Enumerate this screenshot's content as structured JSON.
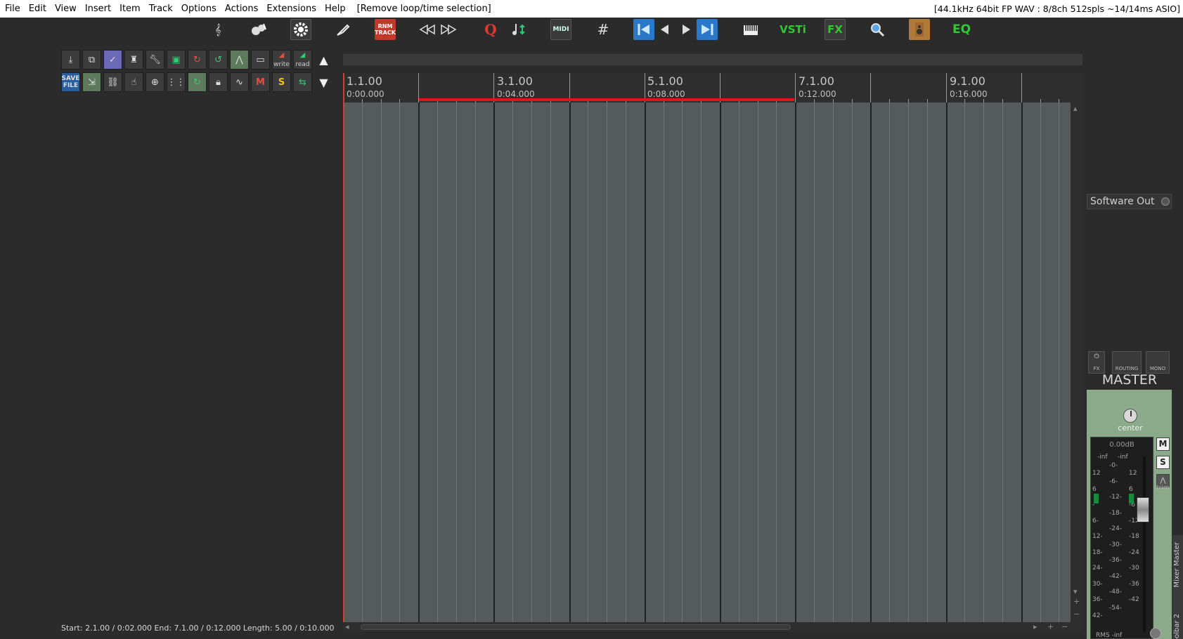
{
  "menubar": {
    "items": [
      "File",
      "Edit",
      "View",
      "Insert",
      "Item",
      "Track",
      "Options",
      "Actions",
      "Extensions",
      "Help"
    ],
    "action_hint": "[Remove loop/time selection]",
    "audio_status": "[44.1kHz 64bit FP WAV : 8/8ch 512spls ~14/14ms ASIO]"
  },
  "main_toolbar": {
    "rnm_label": "RNM TRACK",
    "quantize_label": "Q",
    "midi_label": "MIDI",
    "vsti_label": "VSTi",
    "fx_label": "FX",
    "eq_label": "EQ"
  },
  "arrange_toolbar": {
    "save_file_label": "SAVE FILE",
    "write_label": "write",
    "read_label": "read",
    "mute_label": "M",
    "solo_label": "S"
  },
  "ruler": {
    "markers": [
      {
        "bar": "1.1.00",
        "time": "0:00.000"
      },
      {
        "bar": "3.1.00",
        "time": "0:04.000"
      },
      {
        "bar": "5.1.00",
        "time": "0:08.000"
      },
      {
        "bar": "7.1.00",
        "time": "0:12.000"
      },
      {
        "bar": "9.1.00",
        "time": "0:16.000"
      }
    ]
  },
  "status_line": "Start: 2.1.00 / 0:02.000 End: 7.1.00 / 0:12.000 Length: 5.00 / 0:10.000",
  "master": {
    "output": "Software Out",
    "fx_label": "FX",
    "routing_label": "ROUTING",
    "mono_label": "MONO",
    "title": "MASTER",
    "pan_label": "center",
    "volume_readout": "0.00dB",
    "peak_left": "-inf",
    "peak_right": "-inf",
    "mute_label": "M",
    "solo_label": "S",
    "trim_label": "trim",
    "rms_label": "RMS",
    "rms_value": "-inf",
    "scale_left": [
      "12",
      "6",
      "-",
      "6-",
      "12-",
      "18-",
      "24-",
      "30-",
      "36-",
      "42-"
    ],
    "scale_mid": [
      "-0-",
      "-6-",
      "-12-",
      "-18-",
      "-24-",
      "-30-",
      "-36-",
      "-42-",
      "-48-",
      "-54-"
    ],
    "scale_right": [
      "12",
      "6",
      "-6",
      "-12",
      "-18",
      "-24",
      "-30",
      "-36",
      "-42"
    ]
  },
  "docker": {
    "tab_label": "Mixer Master",
    "toolbar_label": "oolbar 2"
  },
  "colors": {
    "selection": "#e01515",
    "master_strip": "#8aaa8a",
    "grid_bg": "#555a5a"
  }
}
